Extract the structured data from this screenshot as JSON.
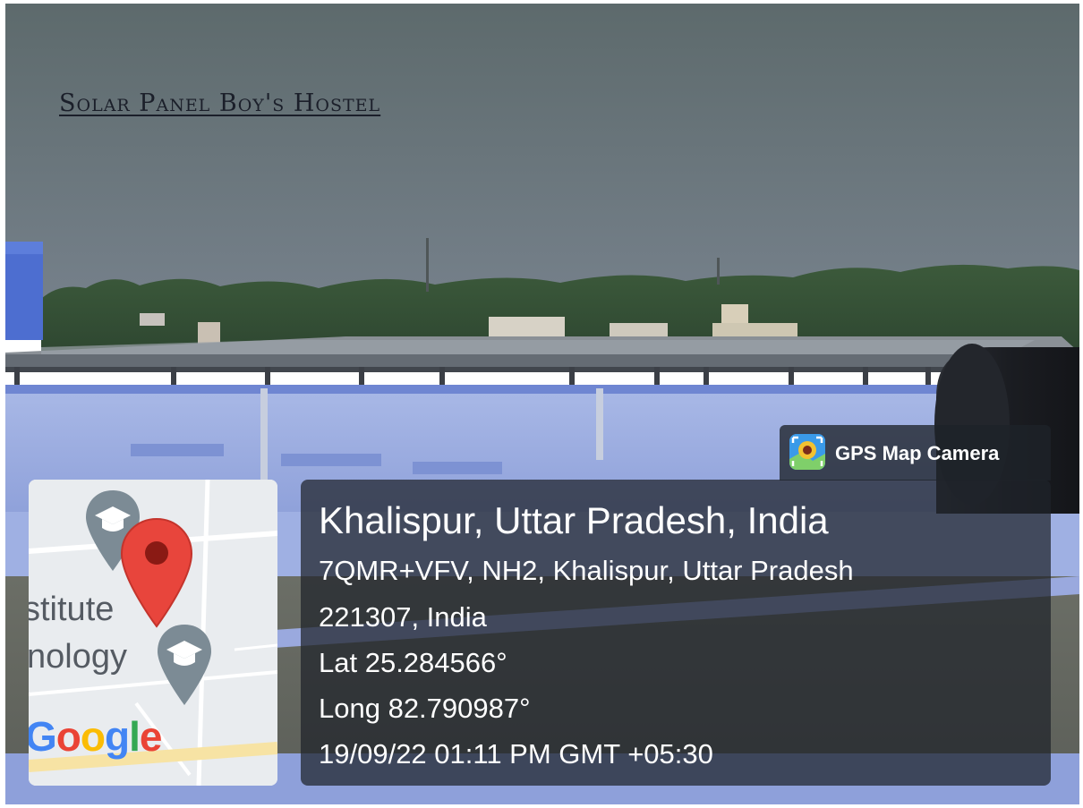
{
  "caption": "Solar Panel Boy's Hostel",
  "badge": {
    "app_name": "GPS Map Camera",
    "icon": "gps-map-camera-icon"
  },
  "map": {
    "label_line1": "stitute",
    "label_line2": "nology",
    "google": [
      "G",
      "o",
      "o",
      "g",
      "l",
      "e"
    ],
    "google_colors": [
      "#4285F4",
      "#EA4335",
      "#FBBC05",
      "#4285F4",
      "#34A853",
      "#EA4335"
    ],
    "icons": [
      "graduation-cap-icon",
      "location-pin-icon"
    ]
  },
  "location": {
    "place": "Khalispur, Uttar Pradesh, India",
    "address_line1": "7QMR+VFV, NH2, Khalispur, Uttar Pradesh",
    "address_line2": "221307, India",
    "latitude": "Lat 25.284566°",
    "longitude": "Long 82.790987°",
    "timestamp": "19/09/22 01:11 PM GMT +05:30"
  }
}
